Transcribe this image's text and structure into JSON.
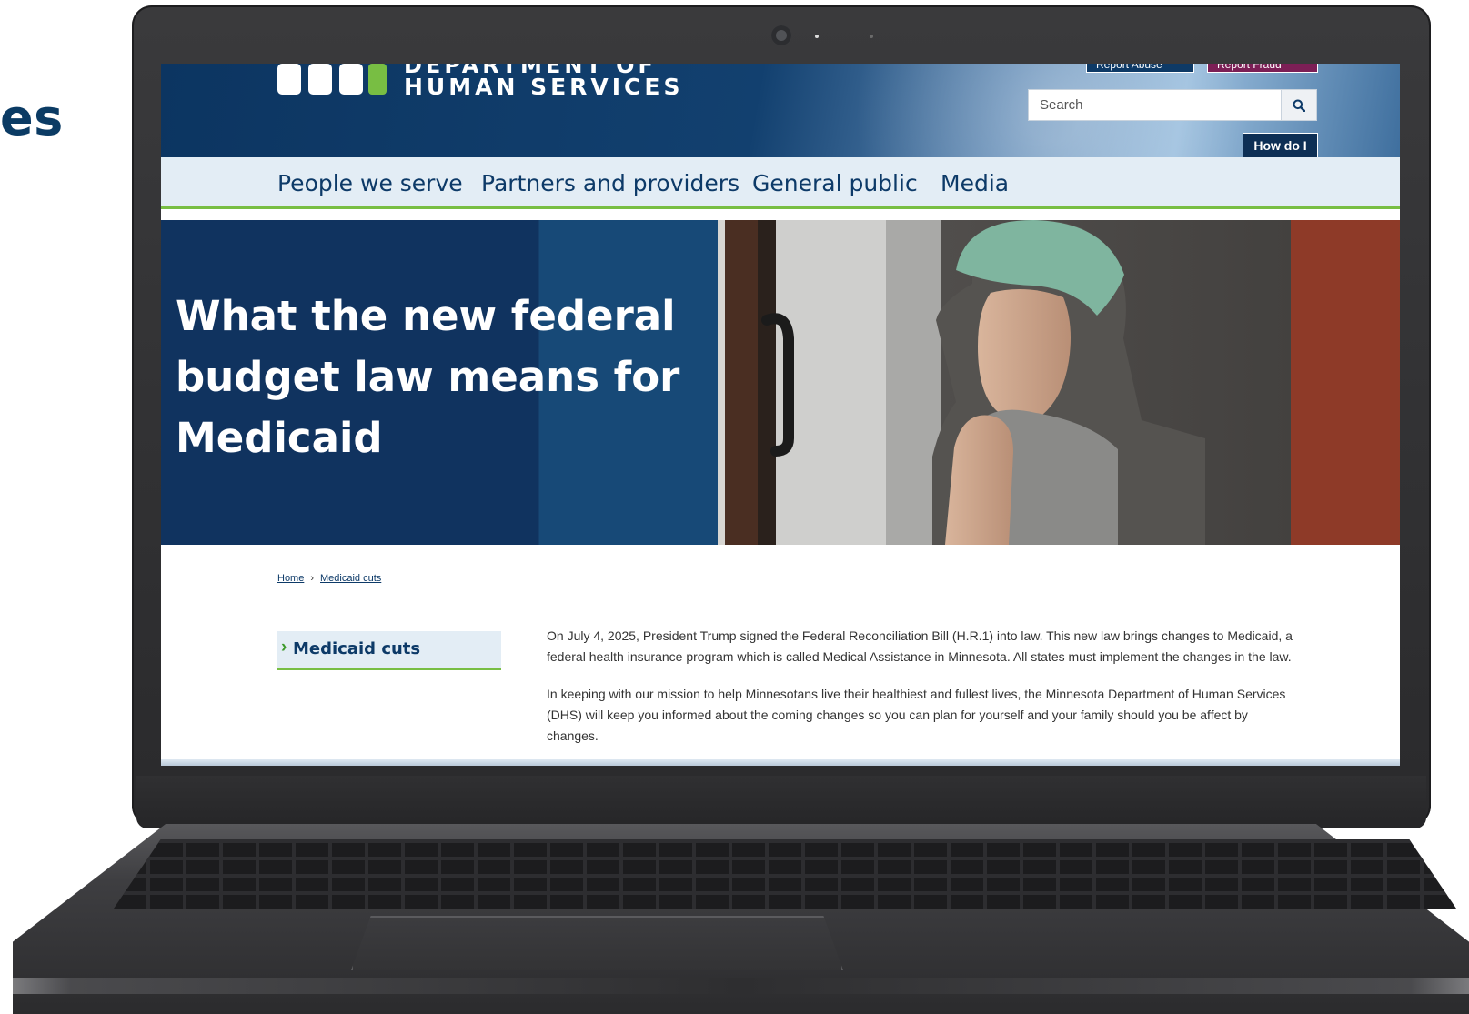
{
  "slide": {
    "title_fragment": "es"
  },
  "site": {
    "logo_line1": "DEPARTMENT OF",
    "logo_line2": "HUMAN SERVICES",
    "utility": {
      "report_abuse": "Report Abuse",
      "report_fraud": "Report Fraud"
    },
    "search": {
      "placeholder": "Search"
    },
    "how_do_i": "How do I"
  },
  "nav": {
    "items": [
      {
        "label": "People we serve"
      },
      {
        "label": "Partners and providers"
      },
      {
        "label": "General public"
      },
      {
        "label": "Media"
      }
    ]
  },
  "hero": {
    "title": "What the new federal budget law means for Medicaid"
  },
  "breadcrumb": {
    "home": "Home",
    "sep": "›",
    "current": "Medicaid cuts"
  },
  "sidebar": {
    "active_item": "Medicaid cuts"
  },
  "content": {
    "paragraphs": [
      "On July 4, 2025, President Trump signed the Federal Reconciliation Bill (H.R.1) into law. This new law brings  changes to Medicaid, a federal health insurance program which is called Medical Assistance in Minnesota. All states must implement the changes in the law.",
      "In keeping with our mission to help Minnesotans live their healthiest and fullest lives, the Minnesota Department of Human Services (DHS) will keep you informed about the coming changes so you can plan for yourself and your family should you be affect by changes."
    ]
  },
  "icons": {
    "search": "search-icon",
    "chevron": "chevron-right-icon",
    "camera": "webcam-icon"
  },
  "colors": {
    "brand_navy": "#0d3a68",
    "accent_green": "#78be43",
    "nav_bg": "#e3edf5"
  }
}
